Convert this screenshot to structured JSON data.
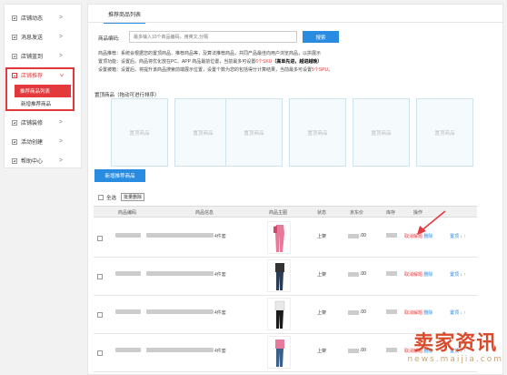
{
  "sidebar": {
    "items": [
      {
        "label": "店铺动态"
      },
      {
        "label": "消息发送"
      },
      {
        "label": "店铺蓝到"
      },
      {
        "label": "店铺推荐"
      },
      {
        "label": "店铺装修"
      },
      {
        "label": "活动创建"
      },
      {
        "label": "帮助中心"
      }
    ],
    "sub_items": [
      {
        "label": "推荐商品列表"
      },
      {
        "label": "新增推荐商品"
      }
    ]
  },
  "tab": {
    "label": "推荐商品列表"
  },
  "search": {
    "label": "商品编码:",
    "placeholder": "最多输入10个商品编码，用英文,分隔",
    "button": "搜索"
  },
  "descriptions": {
    "line1": "商品推荐：系统会根据您的置顶商品、推荐商品等，及算法推荐商品，共同产品最佳向用户浏览商品，以拱展示",
    "line2_a": "置顶功能：设置后，商品将优化放在PC、APP 商品最前位置，当前最多可设置",
    "line2_red": "6个SKU",
    "line2_b": "（高单先进，越进越晚）",
    "line3_a": "设置被箱：设置后，将提升该商品搜索前端展示位置，设置个数为您的包括得分计算结果，当前最多可设置",
    "line3_red": "5个SPU",
    "line3_b": "。"
  },
  "slots": {
    "label": "置顶商品（拖动可进行排序）",
    "items": [
      "置顶商品",
      "置顶商品",
      "置顶商品",
      "置顶商品",
      "置顶商品",
      "置顶商品"
    ]
  },
  "add_button": "新增推荐商品",
  "bulk": {
    "select_all": "全选",
    "delete": "批量删除"
  },
  "table": {
    "headers": [
      "商品编码",
      "商品信息",
      "商品主图",
      "状态",
      "京东价",
      "库存",
      "操作"
    ],
    "rows": [
      {
        "info_end": "4件套",
        "status": "上架",
        "price": ".00",
        "cancel": "取消解题",
        "delete": "删除",
        "move": "置顶"
      },
      {
        "info_end": "4件套",
        "status": "上架",
        "price": ".00",
        "cancel": "取消解题",
        "delete": "删除",
        "move": "置顶"
      },
      {
        "info_end": "4件套",
        "status": "上架",
        "price": ".00",
        "cancel": "取消解题",
        "delete": "删除",
        "move": "置顶"
      },
      {
        "info_end": "4件套",
        "status": "上架",
        "price": ".00",
        "cancel": "取消解题",
        "delete": "删除",
        "move": "置顶"
      }
    ]
  },
  "watermark": {
    "big": "卖家资讯",
    "small": "news.maijia.com"
  }
}
